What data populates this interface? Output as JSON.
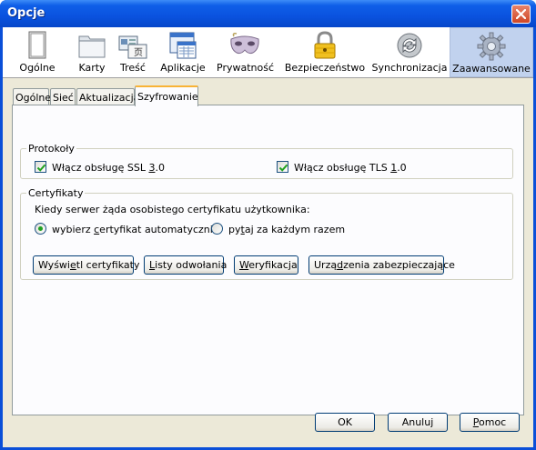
{
  "window": {
    "title": "Opcje"
  },
  "toolbar": {
    "panes": [
      {
        "id": "ogolne",
        "label": "Ogólne",
        "icon": "window-icon"
      },
      {
        "id": "karty",
        "label": "Karty",
        "icon": "folder-tabs-icon"
      },
      {
        "id": "tresc",
        "label": "Treść",
        "icon": "content-icon"
      },
      {
        "id": "aplikacje",
        "label": "Aplikacje",
        "icon": "applications-icon"
      },
      {
        "id": "prywatnosc",
        "label": "Prywatność",
        "icon": "mask-icon"
      },
      {
        "id": "bezpieczenstwo",
        "label": "Bezpieczeństwo",
        "icon": "padlock-icon"
      },
      {
        "id": "synchronizacja",
        "label": "Synchronizacja",
        "icon": "sync-icon"
      },
      {
        "id": "zaawansowane",
        "label": "Zaawansowane",
        "icon": "gear-icon",
        "selected": true
      }
    ]
  },
  "tabs": [
    {
      "label": "Ogólne"
    },
    {
      "label": "Sieć"
    },
    {
      "label": "Aktualizacja"
    },
    {
      "label": "Szyfrowanie",
      "active": true
    }
  ],
  "protocols": {
    "legend": "Protokoły",
    "ssl": {
      "label_pre": "Włącz obsługę SSL ",
      "label_key": "3",
      "label_post": ".0",
      "checked": true
    },
    "tls": {
      "label_pre": "Włącz obsługę TLS ",
      "label_key": "1",
      "label_post": ".0",
      "checked": true
    }
  },
  "certificates": {
    "legend": "Certyfikaty",
    "prompt": "Kiedy serwer żąda osobistego certyfikatu użytkownika:",
    "auto": {
      "label_pre": "wybierz ",
      "label_key": "c",
      "label_post": "ertyfikat automatycznie",
      "selected": true
    },
    "ask": {
      "label_pre": "py",
      "label_key": "t",
      "label_post": "aj za każdym razem",
      "selected": false
    },
    "buttons": {
      "view": {
        "pre": "Wyświ",
        "key": "e",
        "post": "tl certyfikaty"
      },
      "revocation": {
        "pre": "",
        "key": "L",
        "post": "isty odwołania"
      },
      "validation": {
        "pre": "",
        "key": "W",
        "post": "eryfikacja"
      },
      "devices": {
        "pre": "Urzą",
        "key": "d",
        "post": "zenia zabezpieczające"
      }
    }
  },
  "footer": {
    "ok": "OK",
    "cancel": "Anuluj",
    "help": {
      "pre": "",
      "key": "P",
      "post": "omoc"
    }
  },
  "colors": {
    "titlebar": "#0a52df",
    "selected_pane": "#c1d2ee",
    "active_tab_accent": "#f8b336",
    "check": "#21a121"
  }
}
